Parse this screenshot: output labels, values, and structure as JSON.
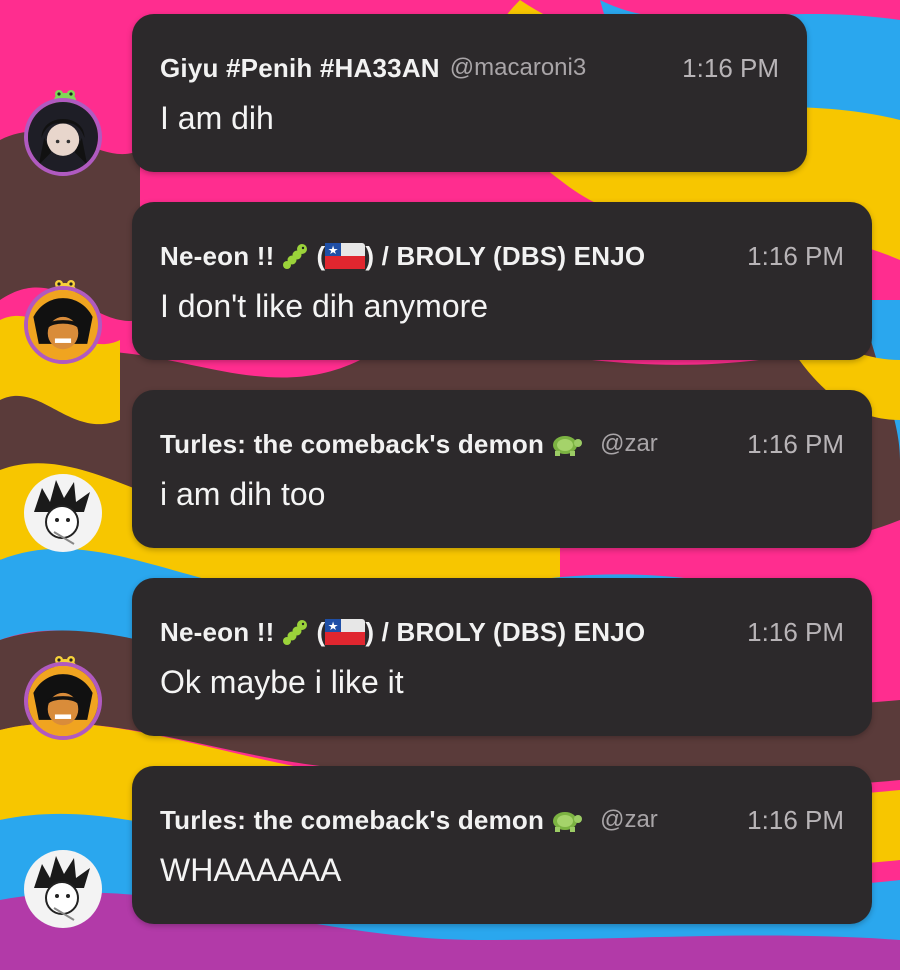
{
  "theme": {
    "bubble_color": "#2c292b",
    "background_colors": [
      "#ff2d8f",
      "#f7c600",
      "#2aa7ee",
      "#5a3b3a",
      "#b23aa8"
    ]
  },
  "messages": [
    {
      "author": "Giyu #Penih #HA33AN",
      "handle": "@macaroni3",
      "time": "1:16 PM",
      "text": "I am dih",
      "avatar": "dark-haired-character-avatar",
      "author_emoji": []
    },
    {
      "author_prefix": "Ne-eon !!",
      "author_suffix": "/ BROLY (DBS) ENJO",
      "handle": "",
      "time": "1:16 PM",
      "text": "I don't like dih anymore",
      "avatar": "broly-avatar",
      "author_emoji": [
        "caterpillar-emoji",
        "chile-flag-emoji"
      ]
    },
    {
      "author": "Turles: the comeback's demon",
      "handle": "@zar",
      "time": "1:16 PM",
      "text": "i am dih too",
      "avatar": "goku-sketch-avatar",
      "author_emoji": [
        "turtle-emoji"
      ]
    },
    {
      "author_prefix": "Ne-eon !!",
      "author_suffix": "/ BROLY (DBS) ENJO",
      "handle": "",
      "time": "1:16 PM",
      "text": "Ok maybe i like it",
      "avatar": "broly-avatar",
      "author_emoji": [
        "caterpillar-emoji",
        "chile-flag-emoji"
      ]
    },
    {
      "author": "Turles: the comeback's demon",
      "handle": "@zar",
      "time": "1:16 PM",
      "text": "WHAAAAAA",
      "avatar": "goku-sketch-avatar",
      "author_emoji": [
        "turtle-emoji"
      ]
    }
  ]
}
